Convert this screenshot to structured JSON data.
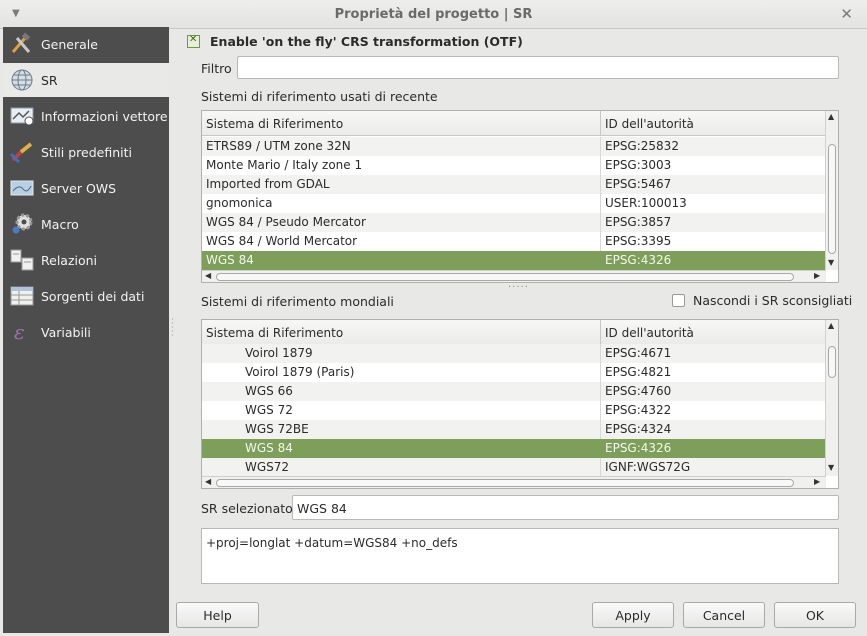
{
  "window": {
    "title": "Proprietà del progetto | SR"
  },
  "sidebar": {
    "items": [
      {
        "label": "Generale",
        "icon": "tools-icon",
        "active": false
      },
      {
        "label": "SR",
        "icon": "globe-icon",
        "active": true
      },
      {
        "label": "Informazioni vettore",
        "icon": "map-info-icon",
        "active": false
      },
      {
        "label": "Stili predefiniti",
        "icon": "paintbrush-icon",
        "active": false
      },
      {
        "label": "Server OWS",
        "icon": "ows-server-icon",
        "active": false
      },
      {
        "label": "Macro",
        "icon": "gear-icon",
        "active": false
      },
      {
        "label": "Relazioni",
        "icon": "relations-icon",
        "active": false
      },
      {
        "label": "Sorgenti dei dati",
        "icon": "table-icon",
        "active": false
      },
      {
        "label": "Variabili",
        "icon": "variables-icon",
        "active": false
      }
    ]
  },
  "otf": {
    "label": "Enable 'on the fly' CRS transformation (OTF)",
    "checked": true
  },
  "filter": {
    "label": "Filtro",
    "value": ""
  },
  "recent": {
    "title": "Sistemi di riferimento usati di recente",
    "columns": [
      "Sistema di Riferimento",
      "ID dell'autorità"
    ],
    "rows": [
      {
        "name": "ETRS89 / UTM zone 32N",
        "id": "EPSG:25832"
      },
      {
        "name": "Monte Mario / Italy zone 1",
        "id": "EPSG:3003"
      },
      {
        "name": "Imported from GDAL",
        "id": "EPSG:5467"
      },
      {
        "name": "gnomonica",
        "id": "USER:100013"
      },
      {
        "name": "WGS 84 / Pseudo Mercator",
        "id": "EPSG:3857"
      },
      {
        "name": "WGS 84 / World Mercator",
        "id": "EPSG:3395"
      },
      {
        "name": "WGS 84",
        "id": "EPSG:4326",
        "selected": true
      }
    ]
  },
  "world": {
    "title": "Sistemi di riferimento mondiali",
    "hide_deprecated_label": "Nascondi i SR sconsigliati",
    "columns": [
      "Sistema di Riferimento",
      "ID dell'autorità"
    ],
    "rows": [
      {
        "name": "Voirol 1879",
        "id": "EPSG:4671"
      },
      {
        "name": "Voirol 1879 (Paris)",
        "id": "EPSG:4821"
      },
      {
        "name": "WGS 66",
        "id": "EPSG:4760"
      },
      {
        "name": "WGS 72",
        "id": "EPSG:4322"
      },
      {
        "name": "WGS 72BE",
        "id": "EPSG:4324"
      },
      {
        "name": "WGS 84",
        "id": "EPSG:4326",
        "selected": true
      },
      {
        "name": "WGS72",
        "id": "IGNF:WGS72G"
      }
    ]
  },
  "selected": {
    "label": "SR selezionato:",
    "value": "WGS 84",
    "proj": "+proj=longlat +datum=WGS84 +no_defs"
  },
  "buttons": {
    "help": "Help",
    "apply": "Apply",
    "cancel": "Cancel",
    "ok": "OK"
  }
}
